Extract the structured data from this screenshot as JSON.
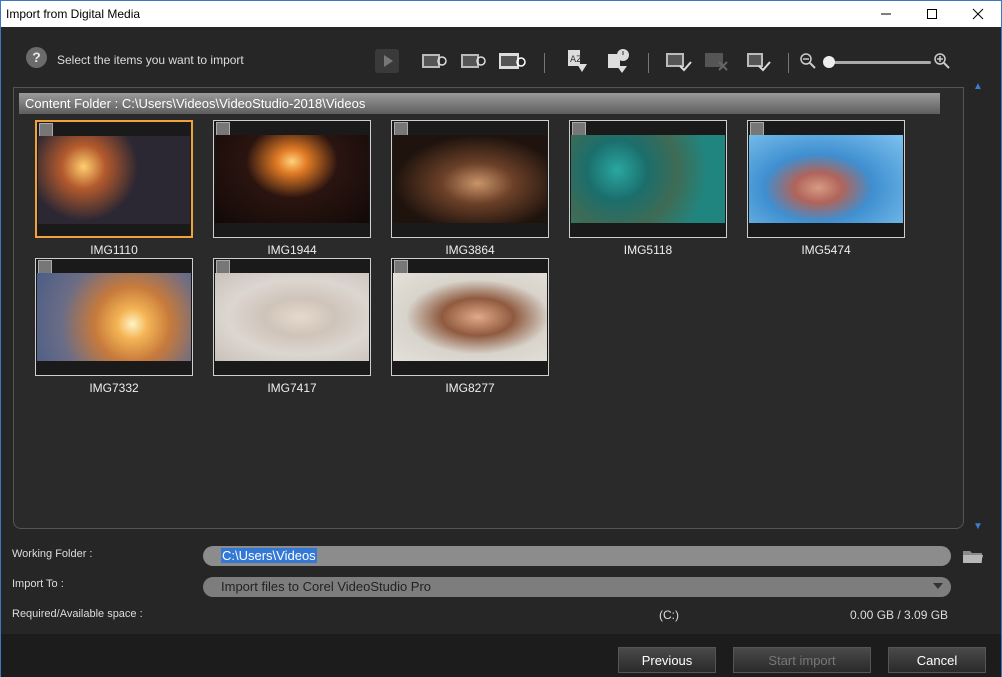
{
  "window": {
    "title": "Import from Digital Media"
  },
  "top": {
    "hint": "Select the items you want to import",
    "help_icon": "?"
  },
  "content": {
    "folder_label": "Content Folder : C:\\Users\\Videos\\VideoStudio-2018\\Videos"
  },
  "items": [
    {
      "name": "IMG1110",
      "selected": true
    },
    {
      "name": "IMG1944",
      "selected": false
    },
    {
      "name": "IMG3864",
      "selected": false
    },
    {
      "name": "IMG5118",
      "selected": false
    },
    {
      "name": "IMG5474",
      "selected": false
    },
    {
      "name": "IMG7332",
      "selected": false
    },
    {
      "name": "IMG7417",
      "selected": false
    },
    {
      "name": "IMG8277",
      "selected": false
    }
  ],
  "form": {
    "working_folder_label": "Working Folder :",
    "working_folder_value": "C:\\Users\\Videos",
    "import_to_label": "Import To :",
    "import_to_value": "Import files to Corel VideoStudio Pro",
    "space_label": "Required/Available space :",
    "drive": "(C:)",
    "space_value": "0.00 GB / 3.09 GB"
  },
  "buttons": {
    "previous": "Previous",
    "start_import": "Start import",
    "cancel": "Cancel"
  },
  "colors": {
    "accent_blue": "#3478d6",
    "selection_orange": "#f0a23c"
  }
}
